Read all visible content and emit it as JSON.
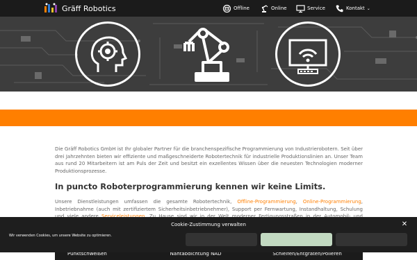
{
  "nav": {
    "brand": "Gräff Robotics",
    "items": [
      {
        "label": "Offline",
        "icon": "robot-head-icon"
      },
      {
        "label": "Online",
        "icon": "robot-arm-icon"
      },
      {
        "label": "Service",
        "icon": "monitor-icon"
      },
      {
        "label": "Kontakt",
        "icon": "phone-icon"
      }
    ]
  },
  "main": {
    "intro": "Die Gräff Robotics GmbH ist Ihr globaler Partner für die branchenspezifische Programmierung von Industrierobotern. Seit über drei Jahrzehnten bieten wir effiziente und maßgeschneiderte Robotertechnik für industrielle Produktionslinien an. Unser Team aus rund 20 Mitarbeitern ist am Puls der Zeit und besitzt ein exzellentes Wissen über die neuesten Technologien moderner Produktionsprozesse.",
    "heading": "In puncto Roboterprogrammierung kennen wir keine Limits.",
    "services_part1": "Unsere Dienstleistungen umfassen die gesamte Robotertechnik, ",
    "link_offline": "Offline-Programmierung",
    "services_part2": ", ",
    "link_online": "Online-Programmierung",
    "services_part3": ", Inbetriebnahme (auch mit zertifiziertem Sicherheitsinbetriebnehmer), Support per Fernwartung, Instandhaltung, Schulung und viele andere ",
    "link_service": "Serviceleistungen",
    "services_part4": ". Zu Hause sind wir in der Welt moderner Fertigungsstraßen in der Automobil- und Zuliefer-"
  },
  "list_strip": [
    "Punktschweißen",
    "Nahtabdichtung NAD",
    "Schleifen/Entgraten/Polieren"
  ],
  "cookie": {
    "title": "Cookie-Zustimmung verwalten",
    "text": "Wir verwenden Cookies, um unsere Website zu optimieren.",
    "close": "✕"
  },
  "colors": {
    "accent": "#ff7f00",
    "nav_bg": "#1b1b1b",
    "accept_button": "#c2d9c1"
  }
}
